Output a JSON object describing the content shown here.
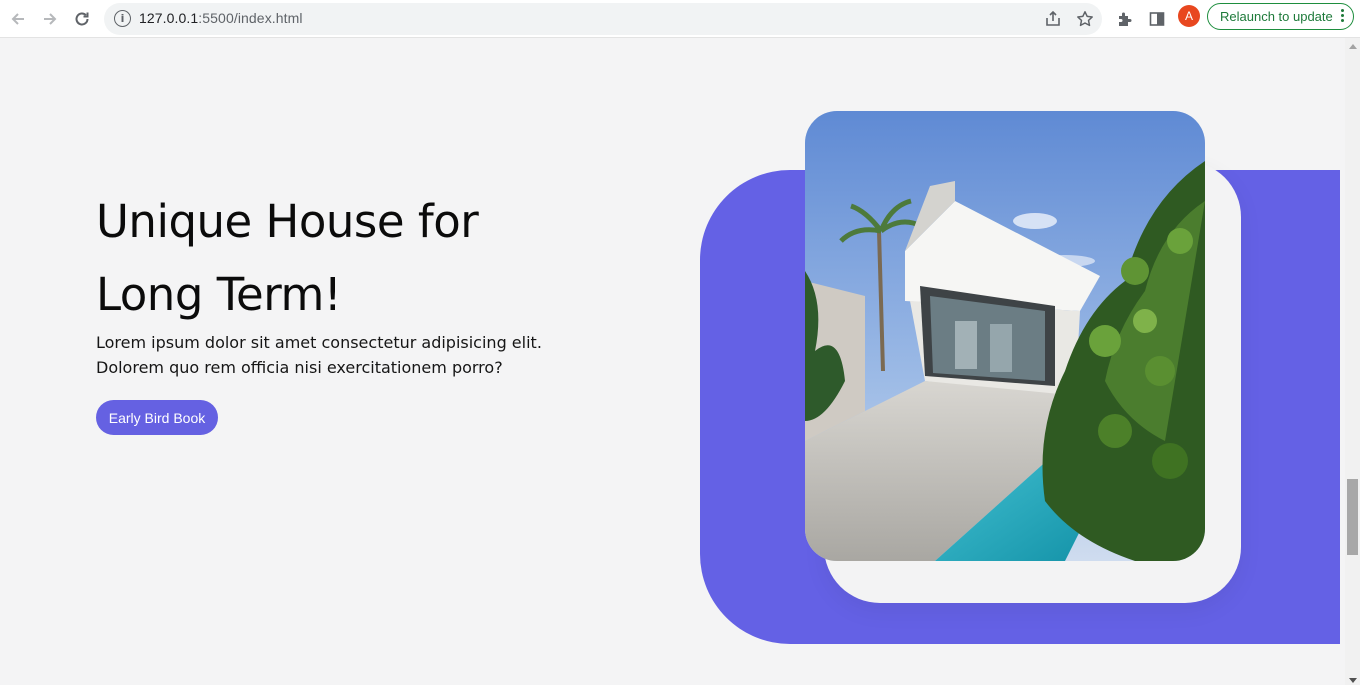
{
  "browser": {
    "url_host": "127.0.0.1",
    "url_rest": ":5500/index.html",
    "avatar_letter": "A",
    "relaunch_label": "Relaunch to update"
  },
  "hero": {
    "title_line1": "Unique House for",
    "title_line2": "Long Term!",
    "description": "Lorem ipsum dolor sit amet consectetur adipisicing elit. Dolorem quo rem officia nisi exercitationem porro?",
    "cta_label": "Early Bird Book"
  },
  "colors": {
    "accent": "#6461e5",
    "button": "#6561e2",
    "background": "#f4f4f5"
  }
}
